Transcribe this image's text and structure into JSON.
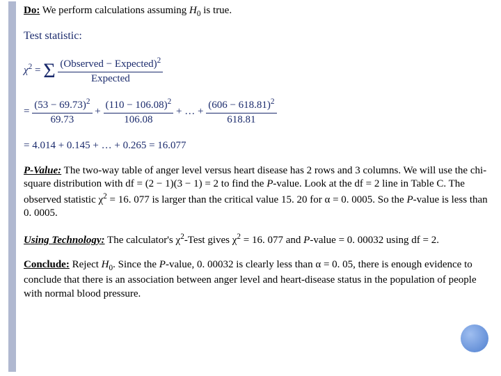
{
  "do": {
    "label": "Do:",
    "text_a": " We perform calculations assuming ",
    "H": "H",
    "sub0": "0",
    "text_b": " is true."
  },
  "ts": {
    "label": "Test statistic:",
    "chi": "χ",
    "sq": "2",
    "eq": " = ",
    "sigma": "Σ",
    "num": "(Observed − Expected)",
    "den": "Expected"
  },
  "expand": {
    "eq": "= ",
    "t1_num": "(53 − 69.73)",
    "t1_den": "69.73",
    "plus1": " + ",
    "t2_num": "(110 − 106.08)",
    "t2_den": "106.08",
    "plus2": " + … + ",
    "t3_num": "(606 − 618.81)",
    "t3_den": "618.81",
    "sq": "2"
  },
  "result_line": "= 4.014 + 0.145 + … + 0.265 = 16.077",
  "pvalue": {
    "label": "P-Value:",
    "t1": " The two-way table of anger level versus heart disease has 2 rows and 3 columns. We will use the chi-square distribution with df = (2 − 1)(3 − 1) = 2 to find the ",
    "P1": "P",
    "t2": "-value. Look at the df = 2 line in Table C. The observed statistic ",
    "chi": "χ",
    "sq": "2",
    "t3": " = 16. 077 is larger than the critical value 15. 20 for α = 0. 0005. So the ",
    "P2": "P",
    "t4": "-value is less than 0. 0005."
  },
  "tech": {
    "label": "Using Technology:",
    "t1": " The calculator's ",
    "chi1": "χ",
    "sq": "2",
    "t2": "-Test gives ",
    "chi2": "χ",
    "t3": " = 16. 077 and ",
    "P": "P",
    "t4": "-value = 0. 00032 using df = 2."
  },
  "conclude": {
    "label": "Conclude:",
    "t1": " Reject ",
    "H": "H",
    "sub0": "0",
    "t2": ". Since the ",
    "P": "P",
    "t3": "-value, 0. 00032 is clearly less than α = 0. 05, there is enough evidence to conclude that there is an association between anger level and heart-disease status in the population of people with normal blood pressure."
  },
  "chart_data": {
    "type": "table",
    "title": "Chi-square test summary",
    "terms": [
      {
        "observed": 53,
        "expected": 69.73,
        "contribution": 4.014
      },
      {
        "observed": 110,
        "expected": 106.08,
        "contribution": 0.145
      },
      {
        "observed": 606,
        "expected": 618.81,
        "contribution": 0.265
      }
    ],
    "chi_square": 16.077,
    "df": 2,
    "alpha": 0.05,
    "critical_value_alpha_0_0005": 15.2,
    "p_value": 0.00032,
    "rows": 2,
    "columns": 3
  }
}
